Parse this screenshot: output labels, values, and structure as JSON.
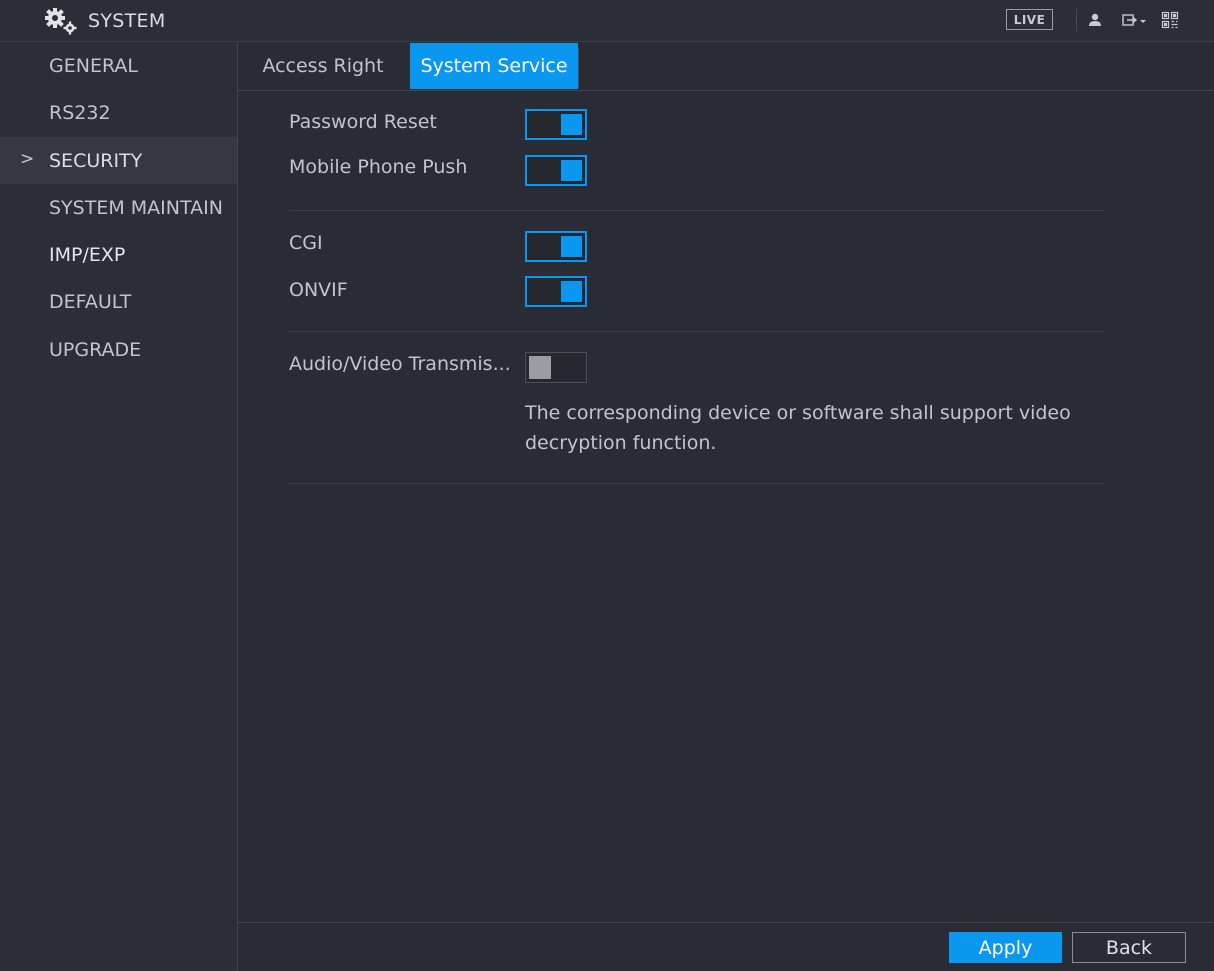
{
  "header": {
    "title": "SYSTEM",
    "icons": [
      "gears-icon",
      "user-icon",
      "logout-icon",
      "qr-code-icon"
    ],
    "live_label": "LIVE"
  },
  "sidebar": {
    "items": [
      {
        "label": "GENERAL"
      },
      {
        "label": "RS232"
      },
      {
        "label": "SECURITY",
        "active": true
      },
      {
        "label": "SYSTEM MAINTAIN"
      },
      {
        "label": "IMP/EXP"
      },
      {
        "label": "DEFAULT"
      },
      {
        "label": "UPGRADE"
      }
    ],
    "active_marker": ">"
  },
  "tabs": [
    {
      "label": "Access Right"
    },
    {
      "label": "System Service",
      "active": true
    }
  ],
  "settings": {
    "password_reset": {
      "label": "Password Reset",
      "enabled": true
    },
    "mobile_phone_push": {
      "label": "Mobile Phone Push",
      "enabled": true
    },
    "cgi": {
      "label": "CGI",
      "enabled": true
    },
    "onvif": {
      "label": "ONVIF",
      "enabled": true
    },
    "av_transmission": {
      "label": "Audio/Video Transmis...",
      "enabled": false,
      "note": "The corresponding device or software shall support video decryption function."
    }
  },
  "footer": {
    "apply_label": "Apply",
    "back_label": "Back"
  },
  "colors": {
    "accent": "#0a97f0",
    "background": "#2a2c35",
    "sidebar": "#2c2e37"
  }
}
